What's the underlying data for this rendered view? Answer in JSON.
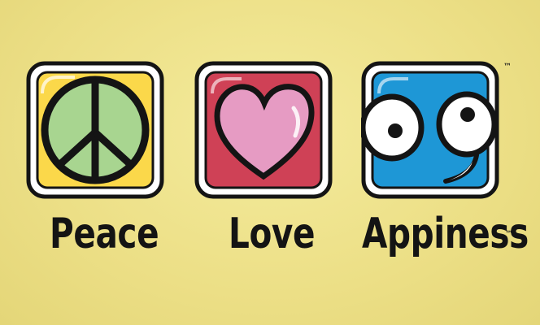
{
  "icons": {
    "peace": "peace-sign-icon",
    "love": "heart-icon",
    "happy": "googly-eyes-smile-icon"
  },
  "words": {
    "peace": "Peace",
    "love": "Love",
    "app": "Appiness"
  },
  "trademark": "™",
  "colors": {
    "background": "#efe48e",
    "peace_tile": "#fbd84a",
    "peace_symbol": "#a8d590",
    "love_tile": "#cf4156",
    "heart": "#e69bc3",
    "happy_tile": "#1e97d6",
    "outline": "#141414"
  }
}
